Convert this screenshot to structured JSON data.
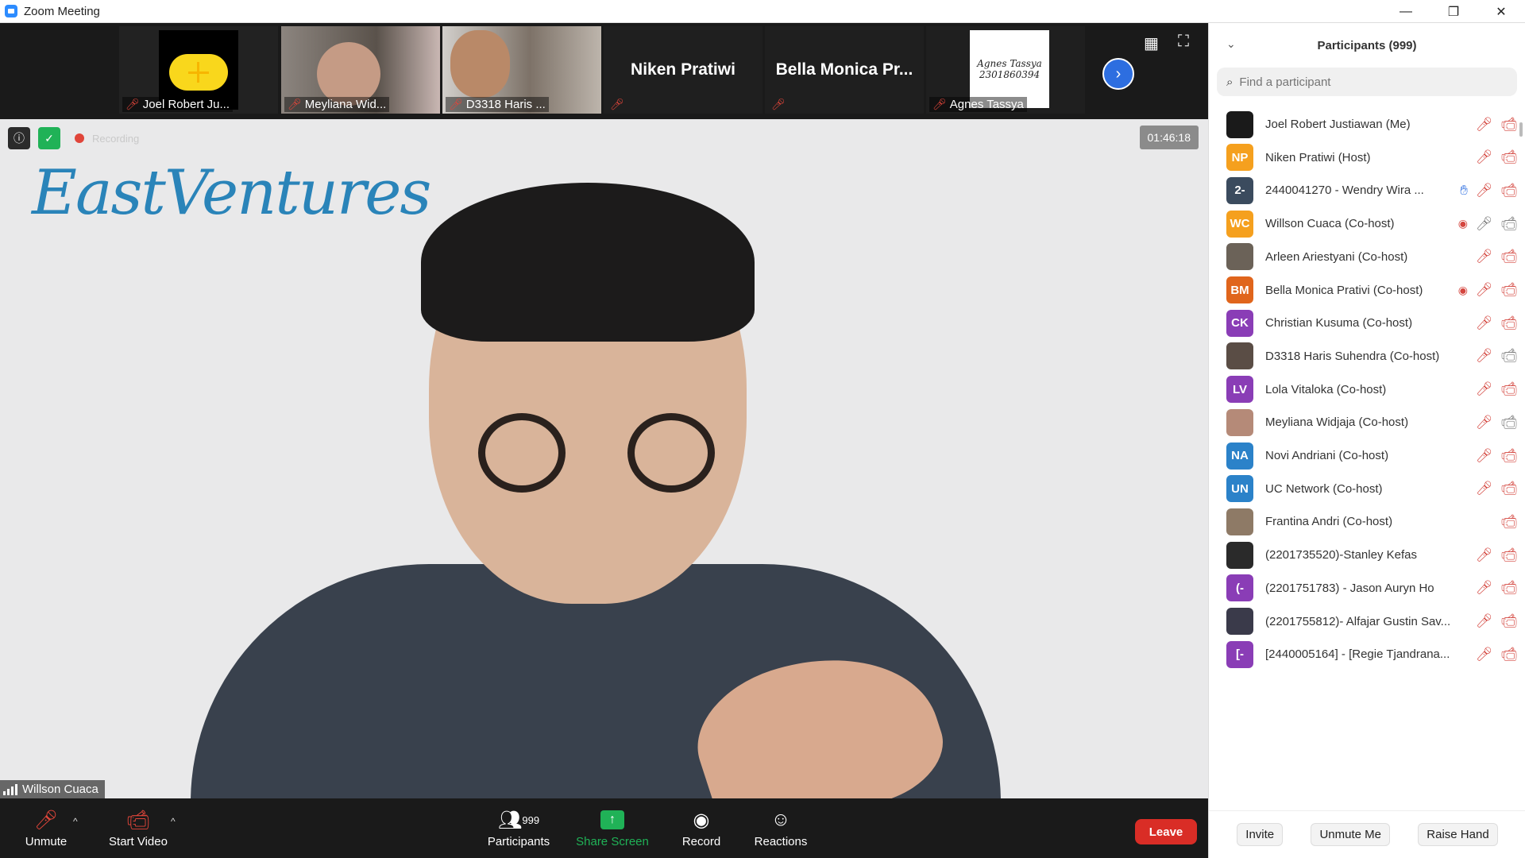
{
  "window": {
    "title": "Zoom Meeting",
    "min": "—",
    "max": "❐",
    "close": "✕"
  },
  "strip": {
    "thumbs": [
      {
        "name": "Joel Robert Ju..."
      },
      {
        "name": "Meyliana Wid..."
      },
      {
        "name": "D3318 Haris ..."
      },
      {
        "name": "Niken Pratiwi"
      },
      {
        "name": "Bella Monica Pr..."
      },
      {
        "name": "Agnes Tassya",
        "card_text": "Agnes Tassya 2301860394"
      }
    ]
  },
  "main": {
    "logo_text": "EastVentures",
    "recording_label": "Recording",
    "timer": "01:46:18",
    "speaker": "Willson Cuaca"
  },
  "toolbar": {
    "unmute": "Unmute",
    "start_video": "Start Video",
    "participants": "Participants",
    "participants_count": "999",
    "share_screen": "Share Screen",
    "record": "Record",
    "reactions": "Reactions",
    "leave": "Leave"
  },
  "panel": {
    "title": "Participants (999)",
    "search_placeholder": "Find a participant",
    "participants": [
      {
        "name": "Joel Robert Justiawan (Me)",
        "initials": "",
        "color": "#1a1a1a",
        "icons": [
          "mic-off",
          "video-off"
        ]
      },
      {
        "name": "Niken Pratiwi (Host)",
        "initials": "NP",
        "color": "#f5a01e",
        "icons": [
          "mic-off",
          "video-off"
        ]
      },
      {
        "name": "2440041270 - Wendry Wira ...",
        "initials": "2-",
        "color": "#3b4b5e",
        "icons": [
          "hand",
          "mic-off",
          "video-off"
        ]
      },
      {
        "name": "Willson Cuaca (Co-host)",
        "initials": "WC",
        "color": "#f5a01e",
        "icons": [
          "rec",
          "mic-on",
          "video-on"
        ]
      },
      {
        "name": "Arleen Ariestyani (Co-host)",
        "initials": "",
        "color": "#6b6258",
        "icons": [
          "mic-off",
          "video-off"
        ]
      },
      {
        "name": "Bella Monica Prativi (Co-host)",
        "initials": "BM",
        "color": "#e0651c",
        "icons": [
          "rec",
          "mic-off",
          "video-off"
        ]
      },
      {
        "name": "Christian Kusuma (Co-host)",
        "initials": "CK",
        "color": "#8a3db6",
        "icons": [
          "mic-off",
          "video-off"
        ]
      },
      {
        "name": "D3318 Haris Suhendra (Co-host)",
        "initials": "",
        "color": "#5a4d45",
        "icons": [
          "mic-off",
          "video-on"
        ]
      },
      {
        "name": "Lola Vitaloka (Co-host)",
        "initials": "LV",
        "color": "#8a3db6",
        "icons": [
          "mic-off",
          "video-off"
        ]
      },
      {
        "name": "Meyliana Widjaja (Co-host)",
        "initials": "",
        "color": "#b58a78",
        "icons": [
          "mic-off",
          "video-on"
        ]
      },
      {
        "name": "Novi Andriani (Co-host)",
        "initials": "NA",
        "color": "#2b82c9",
        "icons": [
          "mic-off",
          "video-off"
        ]
      },
      {
        "name": "UC Network (Co-host)",
        "initials": "UN",
        "color": "#2b82c9",
        "icons": [
          "mic-off",
          "video-off"
        ]
      },
      {
        "name": "Frantina Andri (Co-host)",
        "initials": "",
        "color": "#8e7a66",
        "icons": [
          "video-off"
        ]
      },
      {
        "name": "(2201735520)-Stanley Kefas",
        "initials": "",
        "color": "#2a2a2a",
        "icons": [
          "mic-off",
          "video-off"
        ]
      },
      {
        "name": "(2201751783) - Jason Auryn Ho",
        "initials": "(-",
        "color": "#8a3db6",
        "icons": [
          "mic-off",
          "video-off"
        ]
      },
      {
        "name": "(2201755812)- Alfajar Gustin Sav...",
        "initials": "",
        "color": "#3a3a4a",
        "icons": [
          "mic-off",
          "video-off"
        ]
      },
      {
        "name": "[2440005164] - [Regie Tjandrana...",
        "initials": "[-",
        "color": "#8a3db6",
        "icons": [
          "mic-off",
          "video-off"
        ]
      }
    ],
    "footer": {
      "invite": "Invite",
      "unmute_me": "Unmute Me",
      "raise_hand": "Raise Hand"
    }
  }
}
